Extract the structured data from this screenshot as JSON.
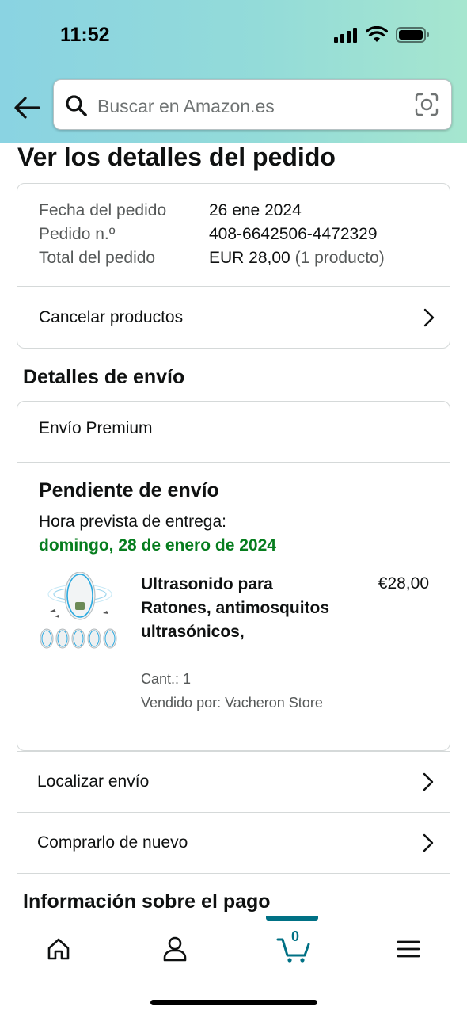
{
  "status_bar": {
    "time": "11:52"
  },
  "search": {
    "placeholder": "Buscar en Amazon.es"
  },
  "page": {
    "title": "Ver los detalles del pedido"
  },
  "order_summary": {
    "date_label": "Fecha del pedido",
    "date_value": "26 ene 2024",
    "number_label": "Pedido n.º",
    "number_value": "408-6642506-4472329",
    "total_label": "Total del pedido",
    "total_value": "EUR 28,00",
    "total_count": "(1 producto)",
    "cancel_label": "Cancelar productos"
  },
  "shipping": {
    "section_title": "Detalles de envío",
    "type": "Envío Premium",
    "status": "Pendiente de envío",
    "eta_label": "Hora prevista de entrega:",
    "eta_date": "domingo, 28 de enero de 2024",
    "product": {
      "title": "Ultrasonido para Ratones, antimosquitos ultrasónicos,",
      "price": "€28,00",
      "quantity": "Cant.: 1",
      "seller": "Vendido por: Vacheron Store"
    }
  },
  "actions": {
    "track": "Localizar envío",
    "buy_again": "Comprarlo de nuevo"
  },
  "payment": {
    "section_title": "Información sobre el pago"
  },
  "bottom_nav": {
    "items": [
      "home-icon",
      "account-icon",
      "cart-icon",
      "menu-icon"
    ],
    "cart_count": "0",
    "active": "cart"
  },
  "colors": {
    "accent": "#007185",
    "delivery_green": "#067d1e",
    "header_gradient_start": "#8ad3e2",
    "header_gradient_end": "#a6e6cf"
  }
}
